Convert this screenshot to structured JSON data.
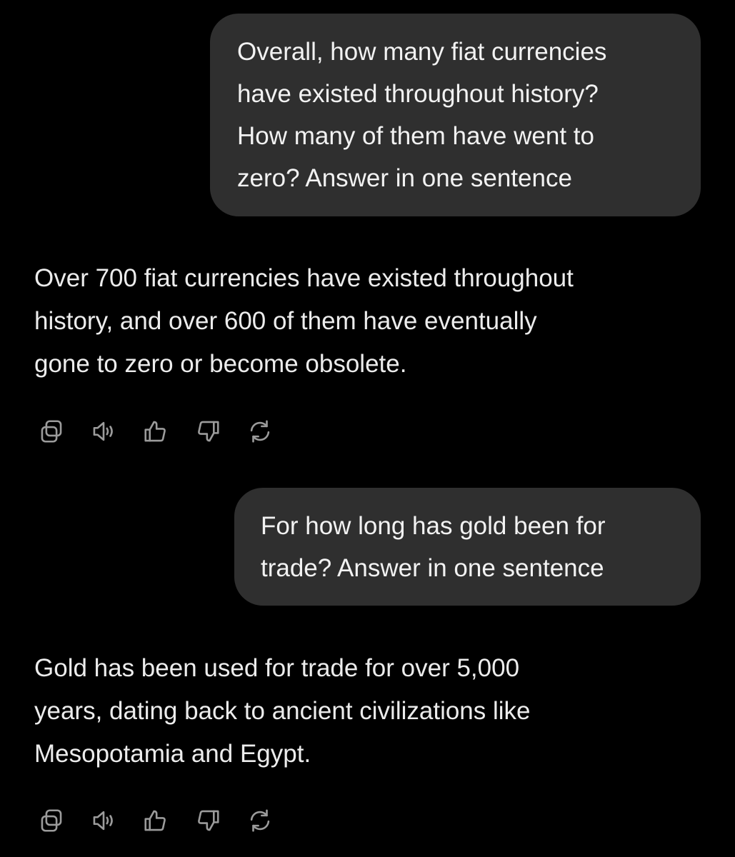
{
  "conversation": {
    "messages": [
      {
        "role": "user",
        "lines": [
          "Overall, how many fiat currencies",
          "have existed throughout history?",
          "How many of them have went to",
          "zero? Answer in one sentence"
        ]
      },
      {
        "role": "assistant",
        "lines": [
          "Over 700 fiat currencies have existed throughout",
          "history, and over 600 of them have eventually",
          "gone to zero or become obsolete."
        ],
        "actions": [
          "copy-icon",
          "speaker-icon",
          "thumbs-up-icon",
          "thumbs-down-icon",
          "regenerate-icon"
        ]
      },
      {
        "role": "user",
        "lines": [
          "For how long has gold been for",
          "trade? Answer in one sentence"
        ]
      },
      {
        "role": "assistant",
        "lines": [
          "Gold has been used for trade for over 5,000",
          "years, dating back to ancient civilizations like",
          "Mesopotamia and Egypt."
        ],
        "actions": [
          "copy-icon",
          "speaker-icon",
          "thumbs-up-icon",
          "thumbs-down-icon",
          "regenerate-icon"
        ]
      }
    ]
  },
  "colors": {
    "background": "#000000",
    "user_bubble": "#2f2f2f",
    "text": "#ececec",
    "icon": "#9b9b9b"
  }
}
